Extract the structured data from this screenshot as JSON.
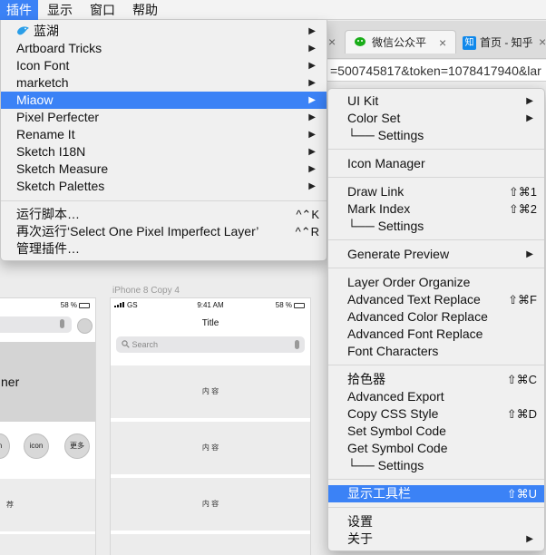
{
  "menubar": {
    "items": [
      "插件",
      "显示",
      "窗口",
      "帮助"
    ]
  },
  "browser": {
    "tabs": [
      {
        "label": "微信公众平",
        "close": "×"
      },
      {
        "label": "首页 - 知乎",
        "close": "×"
      }
    ],
    "zhihu_icon": "知",
    "url_text": "=500745817&token=1078417940&lar",
    "left_close": "×"
  },
  "plugin_menu": {
    "plugins": [
      {
        "label": "蓝湖",
        "arrow": "▶"
      },
      {
        "label": "Artboard Tricks",
        "arrow": "▶"
      },
      {
        "label": "Icon Font",
        "arrow": "▶"
      },
      {
        "label": "marketch",
        "arrow": "▶"
      },
      {
        "label": "Miaow",
        "arrow": "▶"
      },
      {
        "label": "Pixel Perfecter",
        "arrow": "▶"
      },
      {
        "label": "Rename It",
        "arrow": "▶"
      },
      {
        "label": "Sketch I18N",
        "arrow": "▶"
      },
      {
        "label": "Sketch Measure",
        "arrow": "▶"
      },
      {
        "label": "Sketch Palettes",
        "arrow": "▶"
      }
    ],
    "actions": [
      {
        "label": "运行脚本…",
        "shortcut": "^⌃K"
      },
      {
        "label": "再次运行‘Select One Pixel Imperfect Layer’",
        "shortcut": "^⌃R"
      },
      {
        "label": "管理插件…",
        "shortcut": ""
      }
    ]
  },
  "submenu": {
    "groups": [
      [
        {
          "label": "UI Kit",
          "shortcut": "",
          "arrow": "▶"
        },
        {
          "label": "Color Set",
          "shortcut": "",
          "arrow": "▶"
        },
        {
          "label": "└── Settings",
          "shortcut": "",
          "arrow": ""
        }
      ],
      [
        {
          "label": "Icon Manager",
          "shortcut": "",
          "arrow": ""
        }
      ],
      [
        {
          "label": "Draw Link",
          "shortcut": "⇧⌘1",
          "arrow": ""
        },
        {
          "label": "Mark Index",
          "shortcut": "⇧⌘2",
          "arrow": ""
        },
        {
          "label": "└── Settings",
          "shortcut": "",
          "arrow": ""
        }
      ],
      [
        {
          "label": "Generate Preview",
          "shortcut": "",
          "arrow": "▶"
        }
      ],
      [
        {
          "label": "Layer Order Organize",
          "shortcut": "",
          "arrow": ""
        },
        {
          "label": "Advanced Text Replace",
          "shortcut": "⇧⌘F",
          "arrow": ""
        },
        {
          "label": "Advanced Color Replace",
          "shortcut": "",
          "arrow": ""
        },
        {
          "label": "Advanced Font Replace",
          "shortcut": "",
          "arrow": ""
        },
        {
          "label": "Font Characters",
          "shortcut": "",
          "arrow": ""
        }
      ],
      [
        {
          "label": "拾色器",
          "shortcut": "⇧⌘C",
          "arrow": ""
        },
        {
          "label": "Advanced Export",
          "shortcut": "",
          "arrow": ""
        },
        {
          "label": "Copy CSS Style",
          "shortcut": "⇧⌘D",
          "arrow": ""
        },
        {
          "label": "Set Symbol Code",
          "shortcut": "",
          "arrow": ""
        },
        {
          "label": "Get Symbol Code",
          "shortcut": "",
          "arrow": ""
        },
        {
          "label": "└── Settings",
          "shortcut": "",
          "arrow": ""
        }
      ],
      [
        {
          "label": "显示工具栏",
          "shortcut": "⇧⌘U",
          "arrow": ""
        }
      ],
      [
        {
          "label": "设置",
          "shortcut": "",
          "arrow": ""
        },
        {
          "label": "关于",
          "shortcut": "",
          "arrow": "▶"
        }
      ]
    ]
  },
  "canvas": {
    "artboard_label": "iPhone 8 Copy 4",
    "left_board": {
      "battery": "58 %",
      "text_ner": "ner",
      "btn_n": "n",
      "btn_icon": "icon",
      "btn_more": "更多",
      "recommend": "荐"
    },
    "right_board": {
      "carrier": "GS",
      "time": "9:41 AM",
      "battery": "58 %",
      "title": "Title",
      "search_placeholder": "Search",
      "cells": [
        "内 容",
        "内 容",
        "内 容"
      ]
    }
  },
  "colors": {
    "highlight": "#3b82f6",
    "menu_bg": "#f0f0f0",
    "wechat_green": "#1aad19",
    "zhihu_blue": "#0f88eb",
    "lanhu_blue": "#2a9ee8"
  }
}
